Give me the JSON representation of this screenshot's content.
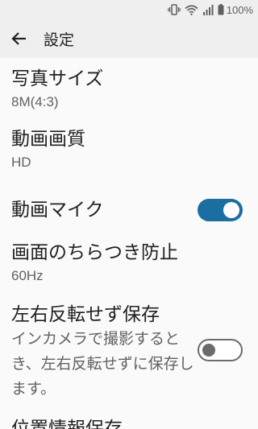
{
  "status_bar": {
    "battery_level": "100%",
    "icons": [
      "vibrate-icon",
      "wifi-icon",
      "signal-icon",
      "battery-icon"
    ]
  },
  "app_bar": {
    "title": "設定",
    "back_icon": "back-arrow-icon"
  },
  "settings": {
    "photo_size": {
      "title": "写真サイズ",
      "value": "8M(4:3)"
    },
    "video_quality": {
      "title": "動画画質",
      "value": "HD"
    },
    "video_mic": {
      "title": "動画マイク",
      "enabled": true
    },
    "anti_flicker": {
      "title": "画面のちらつき防止",
      "value": "60Hz"
    },
    "save_unmirrored": {
      "title": "左右反転せず保存",
      "summary": "インカメラで撮影するとき、左右反転せずに保存します。",
      "enabled": false
    },
    "location_info": {
      "title": "位置情報保存"
    }
  },
  "colors": {
    "accent": "#1a6fa0",
    "background": "#fafafa",
    "app_bar": "#efefef"
  }
}
